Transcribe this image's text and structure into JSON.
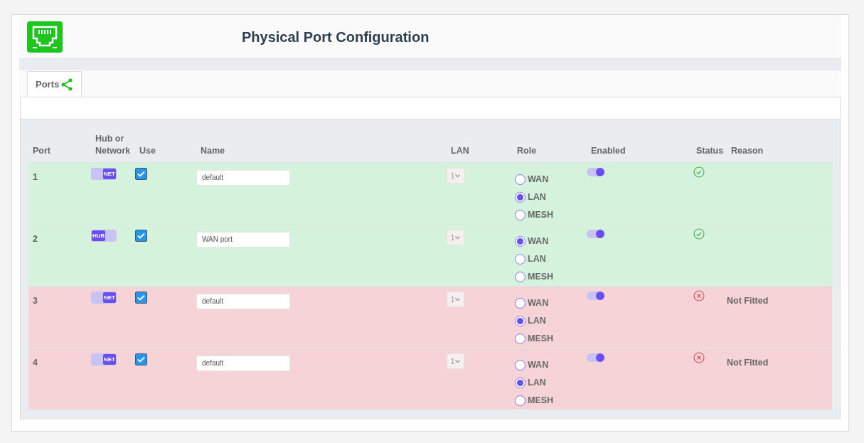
{
  "header": {
    "title": "Physical Port Configuration"
  },
  "tabs": [
    {
      "label": "Ports",
      "selected": true
    }
  ],
  "table": {
    "columns": [
      "Port",
      "Hub or Network",
      "Use",
      "Name",
      "LAN",
      "Role",
      "Enabled",
      "Status",
      "Reason"
    ],
    "rows": [
      {
        "port": "1",
        "mode": {
          "label": "NET",
          "on": true
        },
        "use": true,
        "name": "default",
        "lan": "1",
        "roles": [
          {
            "label": "WAN",
            "selected": false
          },
          {
            "label": "LAN",
            "selected": true
          },
          {
            "label": "MESH",
            "selected": false
          }
        ],
        "enabled": true,
        "kind": "ok"
      },
      {
        "port": "2",
        "mode": {
          "label": "HUB",
          "on": false
        },
        "use": true,
        "name": "WAN port",
        "lan": "1",
        "roles": [
          {
            "label": "WAN",
            "selected": true
          },
          {
            "label": "LAN",
            "selected": false
          },
          {
            "label": "MESH",
            "selected": false
          }
        ],
        "enabled": true,
        "kind": "ok"
      },
      {
        "port": "3",
        "mode": {
          "label": "NET",
          "on": true
        },
        "use": true,
        "name": "default",
        "lan": "1",
        "roles": [
          {
            "label": "WAN",
            "selected": false
          },
          {
            "label": "LAN",
            "selected": true
          },
          {
            "label": "MESH",
            "selected": false
          }
        ],
        "enabled": true,
        "kind": "error",
        "reason": "Not Fitted"
      },
      {
        "port": "4",
        "mode": {
          "label": "NET",
          "on": true
        },
        "use": true,
        "name": "default",
        "lan": "1",
        "roles": [
          {
            "label": "WAN",
            "selected": false
          },
          {
            "label": "LAN",
            "selected": true
          },
          {
            "label": "MESH",
            "selected": false
          }
        ],
        "enabled": true,
        "kind": "error",
        "reason": "Not Fitted"
      }
    ]
  }
}
